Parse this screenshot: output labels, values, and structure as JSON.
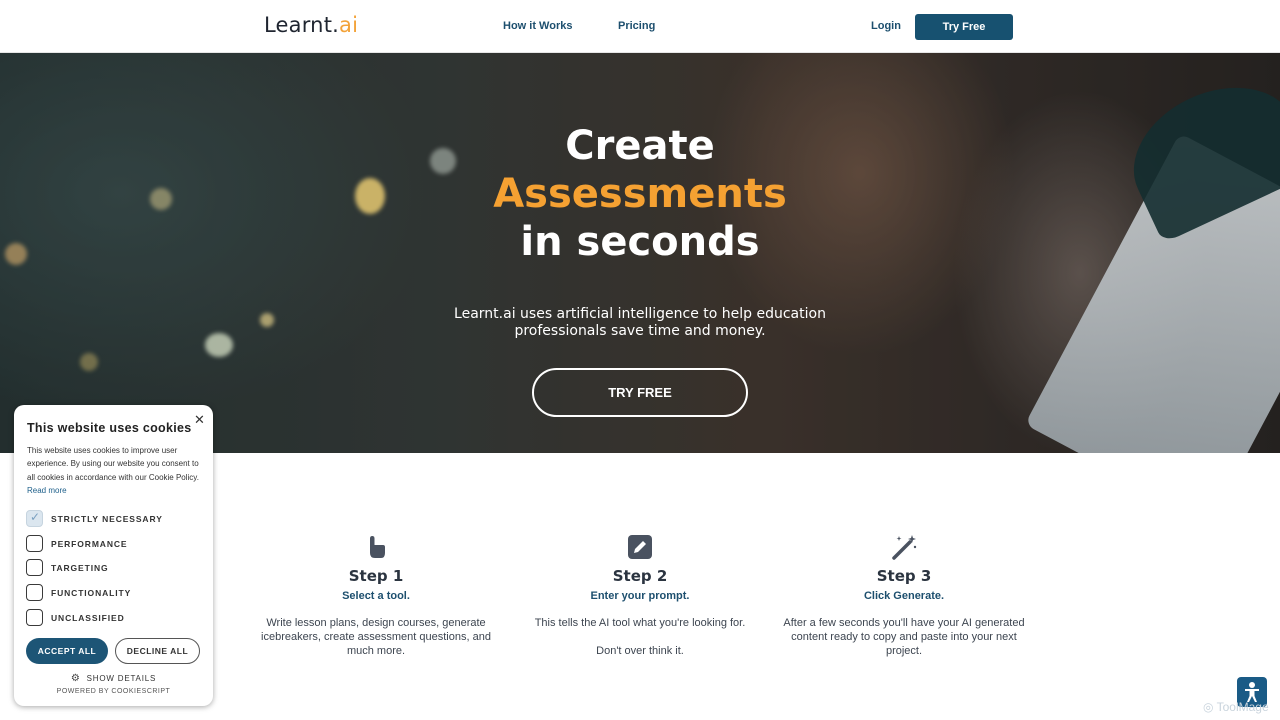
{
  "header": {
    "logo_main": "Learnt.",
    "logo_accent": "ai",
    "nav": [
      "How it Works",
      "Pricing"
    ],
    "login_label": "Login",
    "try_free_label": "Try Free"
  },
  "hero": {
    "title_line1": "Create",
    "title_line2": "Assessments",
    "title_line3": "in seconds",
    "subtitle": "Learnt.ai uses artificial intelligence to help education professionals save time and money.",
    "cta_label": "TRY FREE",
    "accent_color": "#f5a132"
  },
  "steps": [
    {
      "icon": "pointer-hand-icon",
      "title": "Step 1",
      "subtitle": "Select a tool.",
      "description": "Write lesson plans, design courses, generate icebreakers, create assessment questions, and much more."
    },
    {
      "icon": "pencil-square-icon",
      "title": "Step 2",
      "subtitle": "Enter your prompt.",
      "description": "This tells the AI tool what you're looking for.\n\nDon't over think it."
    },
    {
      "icon": "magic-wand-icon",
      "title": "Step 3",
      "subtitle": "Click Generate.",
      "description": "After a few seconds you'll have your AI generated content ready to copy and paste into your next project."
    }
  ],
  "cookie_banner": {
    "title": "This website uses cookies",
    "text": "This website uses cookies to improve user experience. By using our website you consent to all cookies in accordance with our Cookie Policy.",
    "read_more": "Read more",
    "options": [
      {
        "label": "STRICTLY NECESSARY",
        "checked": true
      },
      {
        "label": "PERFORMANCE",
        "checked": false
      },
      {
        "label": "TARGETING",
        "checked": false
      },
      {
        "label": "FUNCTIONALITY",
        "checked": false
      },
      {
        "label": "UNCLASSIFIED",
        "checked": false
      }
    ],
    "accept_label": "ACCEPT ALL",
    "decline_label": "DECLINE ALL",
    "show_details_label": "SHOW DETAILS",
    "powered_by": "POWERED BY COOKIESCRIPT"
  },
  "watermark": "ToolMage",
  "colors": {
    "brand_dark": "#175170",
    "link": "#1d4f6e"
  }
}
